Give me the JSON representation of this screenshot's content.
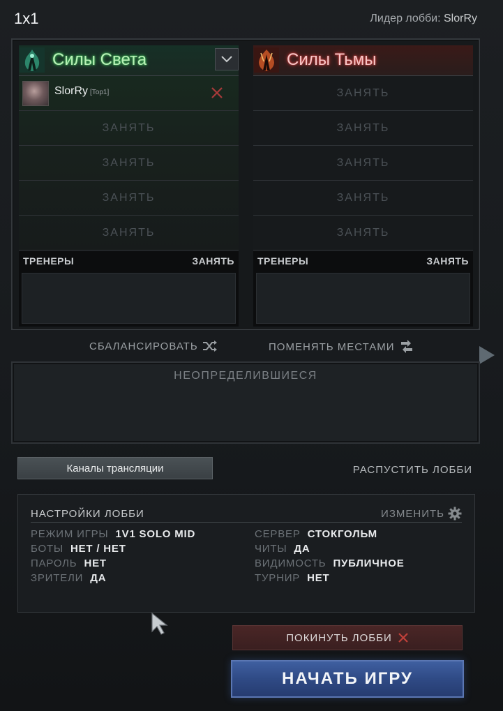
{
  "header": {
    "title": "1x1",
    "leader_prefix": "Лидер лобби:",
    "leader_name": "SlorRy"
  },
  "teams": {
    "radiant": {
      "name": "Силы Света",
      "icon": "radiant-icon",
      "player": {
        "name": "SlorRy",
        "tag": "[Top1]"
      },
      "empty_slots": [
        "ЗАНЯТЬ",
        "ЗАНЯТЬ",
        "ЗАНЯТЬ",
        "ЗАНЯТЬ"
      ],
      "coaches_label": "ТРЕНЕРЫ",
      "coaches_take": "ЗАНЯТЬ"
    },
    "dire": {
      "name": "Силы Тьмы",
      "icon": "dire-icon",
      "empty_slots": [
        "ЗАНЯТЬ",
        "ЗАНЯТЬ",
        "ЗАНЯТЬ",
        "ЗАНЯТЬ",
        "ЗАНЯТЬ"
      ],
      "coaches_label": "ТРЕНЕРЫ",
      "coaches_take": "ЗАНЯТЬ"
    }
  },
  "actions": {
    "balance": "СБАЛАНСИРОВАТЬ",
    "swap": "ПОМЕНЯТЬ МЕСТАМИ"
  },
  "unassigned": {
    "title": "НЕОПРЕДЕЛИВШИЕСЯ"
  },
  "broadcast": {
    "label": "Каналы трансляции"
  },
  "disband": {
    "label": "РАСПУСТИТЬ ЛОББИ"
  },
  "settings": {
    "title": "НАСТРОЙКИ ЛОББИ",
    "edit": "ИЗМЕНИТЬ",
    "left": [
      {
        "key": "РЕЖИМ ИГРЫ",
        "value": "1V1 SOLO MID"
      },
      {
        "key": "БОТЫ",
        "value": "НЕТ / НЕТ"
      },
      {
        "key": "ПАРОЛЬ",
        "value": "НЕТ"
      },
      {
        "key": "ЗРИТЕЛИ",
        "value": "ДА"
      }
    ],
    "right": [
      {
        "key": "СЕРВЕР",
        "value": "СТОКГОЛЬМ"
      },
      {
        "key": "ЧИТЫ",
        "value": "ДА"
      },
      {
        "key": "ВИДИМОСТЬ",
        "value": "ПУБЛИЧНОЕ"
      },
      {
        "key": "ТУРНИР",
        "value": "НЕТ"
      }
    ]
  },
  "leave": {
    "label": "ПОКИНУТЬ ЛОББИ"
  },
  "start": {
    "label": "НАЧАТЬ ИГРУ"
  },
  "colors": {
    "radiant_glow": "#3fbf5a",
    "dire_glow": "#d23a3a",
    "start_button": "#2f4a85",
    "leave_button": "#3a1f20"
  }
}
